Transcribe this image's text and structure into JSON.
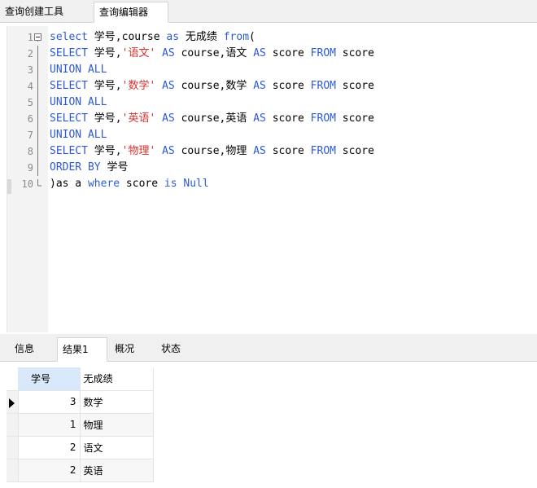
{
  "top_tabs": [
    "查询创建工具",
    "查询编辑器"
  ],
  "editor": {
    "lines": [
      {
        "n": "1",
        "tokens": [
          [
            "kw",
            "select"
          ],
          [
            "",
            " 学号,course "
          ],
          [
            "kw",
            "as"
          ],
          [
            "",
            " 无成绩 "
          ],
          [
            "kw",
            "from"
          ],
          [
            "",
            "("
          ]
        ]
      },
      {
        "n": "2",
        "tokens": [
          [
            "kw",
            "SELECT"
          ],
          [
            "",
            " 学号,"
          ],
          [
            "str",
            "'语文'"
          ],
          [
            "",
            " "
          ],
          [
            "kw",
            "AS"
          ],
          [
            "",
            " course,语文 "
          ],
          [
            "kw",
            "AS"
          ],
          [
            "",
            " score "
          ],
          [
            "kw",
            "FROM"
          ],
          [
            "",
            " score"
          ]
        ]
      },
      {
        "n": "3",
        "tokens": [
          [
            "kw",
            "UNION ALL"
          ]
        ]
      },
      {
        "n": "4",
        "tokens": [
          [
            "kw",
            "SELECT"
          ],
          [
            "",
            " 学号,"
          ],
          [
            "str",
            "'数学'"
          ],
          [
            "",
            " "
          ],
          [
            "kw",
            "AS"
          ],
          [
            "",
            " course,数学 "
          ],
          [
            "kw",
            "AS"
          ],
          [
            "",
            " score "
          ],
          [
            "kw",
            "FROM"
          ],
          [
            "",
            " score"
          ]
        ]
      },
      {
        "n": "5",
        "tokens": [
          [
            "kw",
            "UNION ALL"
          ]
        ]
      },
      {
        "n": "6",
        "tokens": [
          [
            "kw",
            "SELECT"
          ],
          [
            "",
            " 学号,"
          ],
          [
            "str",
            "'英语'"
          ],
          [
            "",
            " "
          ],
          [
            "kw",
            "AS"
          ],
          [
            "",
            " course,英语 "
          ],
          [
            "kw",
            "AS"
          ],
          [
            "",
            " score "
          ],
          [
            "kw",
            "FROM"
          ],
          [
            "",
            " score"
          ]
        ]
      },
      {
        "n": "7",
        "tokens": [
          [
            "kw",
            "UNION ALL"
          ]
        ]
      },
      {
        "n": "8",
        "tokens": [
          [
            "kw",
            "SELECT"
          ],
          [
            "",
            " 学号,"
          ],
          [
            "str",
            "'物理'"
          ],
          [
            "",
            " "
          ],
          [
            "kw",
            "AS"
          ],
          [
            "",
            " course,物理 "
          ],
          [
            "kw",
            "AS"
          ],
          [
            "",
            " score "
          ],
          [
            "kw",
            "FROM"
          ],
          [
            "",
            " score"
          ]
        ]
      },
      {
        "n": "9",
        "tokens": [
          [
            "kw",
            "ORDER BY"
          ],
          [
            "",
            " 学号"
          ]
        ]
      },
      {
        "n": "10",
        "tokens": [
          [
            "",
            ")as a "
          ],
          [
            "kw",
            "where"
          ],
          [
            "",
            " score "
          ],
          [
            "kw",
            "is"
          ],
          [
            "",
            " "
          ],
          [
            "kw",
            "Null"
          ]
        ]
      }
    ]
  },
  "result_tabs": [
    "信息",
    "结果1",
    "概况",
    "状态"
  ],
  "grid": {
    "columns": [
      "学号",
      "无成绩"
    ],
    "rows": [
      [
        "3",
        "数学"
      ],
      [
        "1",
        "物理"
      ],
      [
        "2",
        "语文"
      ],
      [
        "2",
        "英语"
      ]
    ],
    "current_row_marker": "row-pointer-icon"
  },
  "colors": {
    "keyword": "#2c59d7",
    "string": "#d4322c",
    "selected_header": "#d9e9fb"
  }
}
